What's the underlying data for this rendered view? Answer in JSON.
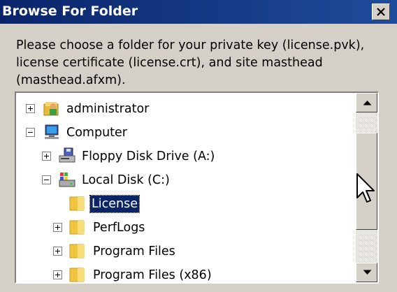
{
  "window": {
    "title": "Browse For Folder",
    "close_label": "Close"
  },
  "prompt": "Please choose a folder for your private key (license.pvk), license certificate (license.crt), and site masthead (masthead.afxm).",
  "tree": {
    "items": [
      {
        "label": "administrator",
        "icon": "user-folder-icon",
        "expander": "plus",
        "selected": false
      },
      {
        "label": "Computer",
        "icon": "computer-icon",
        "expander": "minus",
        "selected": false
      },
      {
        "label": "Floppy Disk Drive (A:)",
        "icon": "floppy-drive-icon",
        "expander": "plus",
        "selected": false
      },
      {
        "label": "Local Disk (C:)",
        "icon": "local-disk-icon",
        "expander": "minus",
        "selected": false
      },
      {
        "label": "License",
        "icon": "folder-icon",
        "expander": "none",
        "selected": true
      },
      {
        "label": "PerfLogs",
        "icon": "folder-icon",
        "expander": "plus",
        "selected": false
      },
      {
        "label": "Program Files",
        "icon": "folder-icon",
        "expander": "plus",
        "selected": false
      },
      {
        "label": "Program Files (x86)",
        "icon": "folder-icon",
        "expander": "plus",
        "selected": false
      }
    ]
  },
  "colors": {
    "titlebar": "#0a246a",
    "face": "#d4d0c8",
    "selection": "#0a246a",
    "folder": "#f0c540"
  }
}
